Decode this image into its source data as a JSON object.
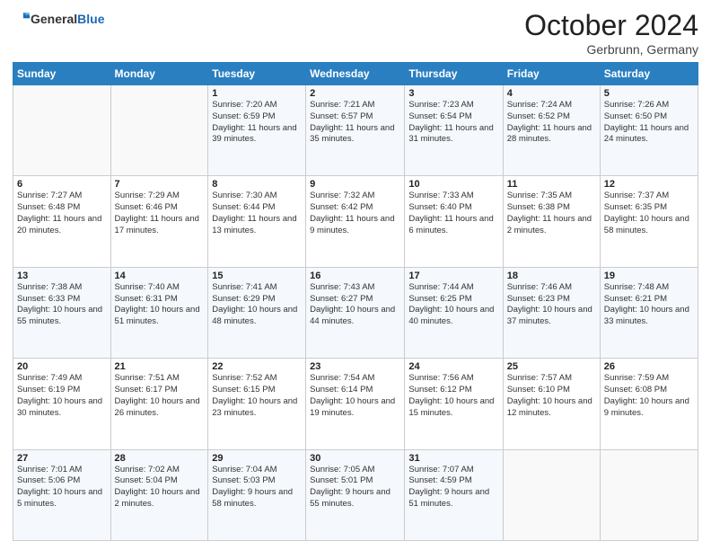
{
  "header": {
    "logo_general": "General",
    "logo_blue": "Blue",
    "month": "October 2024",
    "location": "Gerbrunn, Germany"
  },
  "days_of_week": [
    "Sunday",
    "Monday",
    "Tuesday",
    "Wednesday",
    "Thursday",
    "Friday",
    "Saturday"
  ],
  "weeks": [
    [
      {
        "day": "",
        "info": ""
      },
      {
        "day": "",
        "info": ""
      },
      {
        "day": "1",
        "info": "Sunrise: 7:20 AM\nSunset: 6:59 PM\nDaylight: 11 hours and 39 minutes."
      },
      {
        "day": "2",
        "info": "Sunrise: 7:21 AM\nSunset: 6:57 PM\nDaylight: 11 hours and 35 minutes."
      },
      {
        "day": "3",
        "info": "Sunrise: 7:23 AM\nSunset: 6:54 PM\nDaylight: 11 hours and 31 minutes."
      },
      {
        "day": "4",
        "info": "Sunrise: 7:24 AM\nSunset: 6:52 PM\nDaylight: 11 hours and 28 minutes."
      },
      {
        "day": "5",
        "info": "Sunrise: 7:26 AM\nSunset: 6:50 PM\nDaylight: 11 hours and 24 minutes."
      }
    ],
    [
      {
        "day": "6",
        "info": "Sunrise: 7:27 AM\nSunset: 6:48 PM\nDaylight: 11 hours and 20 minutes."
      },
      {
        "day": "7",
        "info": "Sunrise: 7:29 AM\nSunset: 6:46 PM\nDaylight: 11 hours and 17 minutes."
      },
      {
        "day": "8",
        "info": "Sunrise: 7:30 AM\nSunset: 6:44 PM\nDaylight: 11 hours and 13 minutes."
      },
      {
        "day": "9",
        "info": "Sunrise: 7:32 AM\nSunset: 6:42 PM\nDaylight: 11 hours and 9 minutes."
      },
      {
        "day": "10",
        "info": "Sunrise: 7:33 AM\nSunset: 6:40 PM\nDaylight: 11 hours and 6 minutes."
      },
      {
        "day": "11",
        "info": "Sunrise: 7:35 AM\nSunset: 6:38 PM\nDaylight: 11 hours and 2 minutes."
      },
      {
        "day": "12",
        "info": "Sunrise: 7:37 AM\nSunset: 6:35 PM\nDaylight: 10 hours and 58 minutes."
      }
    ],
    [
      {
        "day": "13",
        "info": "Sunrise: 7:38 AM\nSunset: 6:33 PM\nDaylight: 10 hours and 55 minutes."
      },
      {
        "day": "14",
        "info": "Sunrise: 7:40 AM\nSunset: 6:31 PM\nDaylight: 10 hours and 51 minutes."
      },
      {
        "day": "15",
        "info": "Sunrise: 7:41 AM\nSunset: 6:29 PM\nDaylight: 10 hours and 48 minutes."
      },
      {
        "day": "16",
        "info": "Sunrise: 7:43 AM\nSunset: 6:27 PM\nDaylight: 10 hours and 44 minutes."
      },
      {
        "day": "17",
        "info": "Sunrise: 7:44 AM\nSunset: 6:25 PM\nDaylight: 10 hours and 40 minutes."
      },
      {
        "day": "18",
        "info": "Sunrise: 7:46 AM\nSunset: 6:23 PM\nDaylight: 10 hours and 37 minutes."
      },
      {
        "day": "19",
        "info": "Sunrise: 7:48 AM\nSunset: 6:21 PM\nDaylight: 10 hours and 33 minutes."
      }
    ],
    [
      {
        "day": "20",
        "info": "Sunrise: 7:49 AM\nSunset: 6:19 PM\nDaylight: 10 hours and 30 minutes."
      },
      {
        "day": "21",
        "info": "Sunrise: 7:51 AM\nSunset: 6:17 PM\nDaylight: 10 hours and 26 minutes."
      },
      {
        "day": "22",
        "info": "Sunrise: 7:52 AM\nSunset: 6:15 PM\nDaylight: 10 hours and 23 minutes."
      },
      {
        "day": "23",
        "info": "Sunrise: 7:54 AM\nSunset: 6:14 PM\nDaylight: 10 hours and 19 minutes."
      },
      {
        "day": "24",
        "info": "Sunrise: 7:56 AM\nSunset: 6:12 PM\nDaylight: 10 hours and 15 minutes."
      },
      {
        "day": "25",
        "info": "Sunrise: 7:57 AM\nSunset: 6:10 PM\nDaylight: 10 hours and 12 minutes."
      },
      {
        "day": "26",
        "info": "Sunrise: 7:59 AM\nSunset: 6:08 PM\nDaylight: 10 hours and 9 minutes."
      }
    ],
    [
      {
        "day": "27",
        "info": "Sunrise: 7:01 AM\nSunset: 5:06 PM\nDaylight: 10 hours and 5 minutes."
      },
      {
        "day": "28",
        "info": "Sunrise: 7:02 AM\nSunset: 5:04 PM\nDaylight: 10 hours and 2 minutes."
      },
      {
        "day": "29",
        "info": "Sunrise: 7:04 AM\nSunset: 5:03 PM\nDaylight: 9 hours and 58 minutes."
      },
      {
        "day": "30",
        "info": "Sunrise: 7:05 AM\nSunset: 5:01 PM\nDaylight: 9 hours and 55 minutes."
      },
      {
        "day": "31",
        "info": "Sunrise: 7:07 AM\nSunset: 4:59 PM\nDaylight: 9 hours and 51 minutes."
      },
      {
        "day": "",
        "info": ""
      },
      {
        "day": "",
        "info": ""
      }
    ]
  ]
}
